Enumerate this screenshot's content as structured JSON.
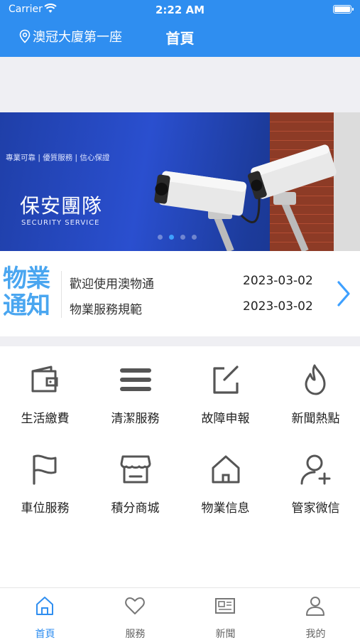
{
  "status_bar": {
    "carrier": "Carrier",
    "time": "2:22 AM"
  },
  "nav": {
    "location": "澳冠大廈第一座",
    "title": "首頁"
  },
  "banner": {
    "tagline": "專業可靠 | 優質服務 | 信心保證",
    "title": "保安團隊",
    "subtitle": "SECURITY SERVICE",
    "dot_count": 4,
    "active_dot": 2
  },
  "notice": {
    "logo_line1": "物業",
    "logo_line2": "通知",
    "items": [
      {
        "title": "歡迎使用澳物通",
        "date": "2023-03-02"
      },
      {
        "title": "物業服務規範",
        "date": "2023-03-02"
      }
    ]
  },
  "services": [
    {
      "label": "生活繳費",
      "icon": "wallet-icon"
    },
    {
      "label": "清潔服務",
      "icon": "menu-lines-icon"
    },
    {
      "label": "故障申報",
      "icon": "edit-icon"
    },
    {
      "label": "新聞熱點",
      "icon": "flame-icon"
    },
    {
      "label": "車位服務",
      "icon": "flag-icon"
    },
    {
      "label": "積分商城",
      "icon": "store-icon"
    },
    {
      "label": "物業信息",
      "icon": "home-icon"
    },
    {
      "label": "管家微信",
      "icon": "add-user-icon"
    }
  ],
  "tabs": [
    {
      "label": "首頁",
      "icon": "home-icon",
      "active": true
    },
    {
      "label": "服務",
      "icon": "heart-icon",
      "active": false
    },
    {
      "label": "新聞",
      "icon": "news-icon",
      "active": false
    },
    {
      "label": "我的",
      "icon": "user-icon",
      "active": false
    }
  ],
  "colors": {
    "accent": "#2f8ef0",
    "logo": "#4aa6f0",
    "icon": "#555555"
  }
}
